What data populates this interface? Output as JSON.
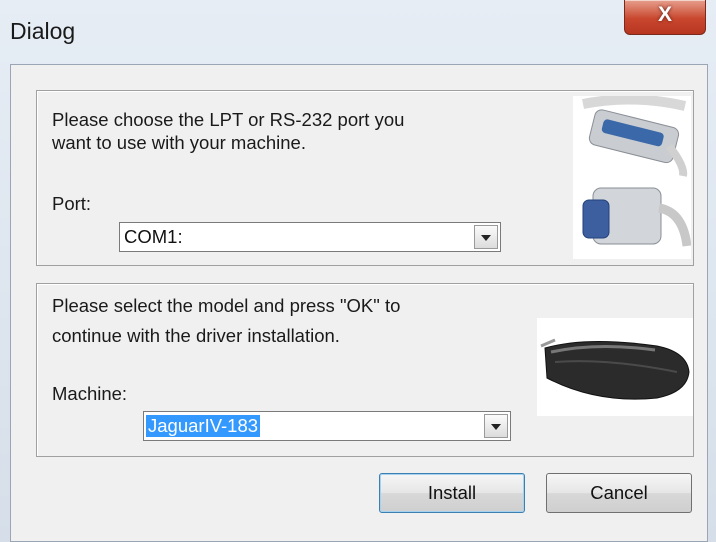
{
  "window": {
    "title": "Dialog",
    "close_label": "X"
  },
  "port_group": {
    "text_line1": "Please choose the LPT or RS-232 port you",
    "text_line2": "want to use  with your machine.",
    "port_label": "Port:",
    "port_value": "COM1:",
    "image_icons": [
      "parallel-cable-icon",
      "serial-connector-icon"
    ]
  },
  "machine_group": {
    "text_line1": "Please select the model and press \"OK\" to",
    "text_line2": "continue with the driver installation.",
    "machine_label": "Machine:",
    "machine_value": "JaguarIV-183",
    "image_icon": "cutting-plotter-icon"
  },
  "buttons": {
    "install": "Install",
    "cancel": "Cancel"
  }
}
